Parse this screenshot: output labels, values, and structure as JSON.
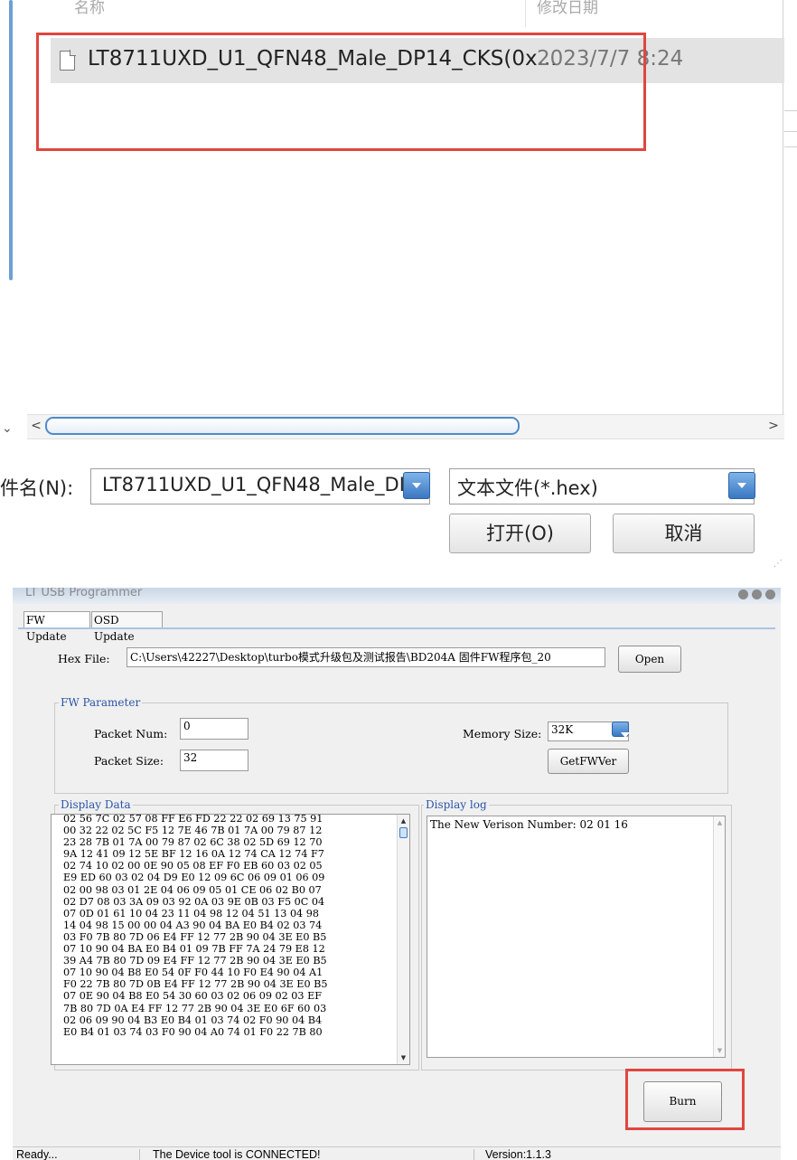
{
  "file_dialog": {
    "col_name_header": "名称",
    "col_date_header": "修改日期",
    "file": {
      "name": "LT8711UXD_U1_QFN48_Male_DP14_CKS(0x...",
      "modified": "2023/7/7 8:24"
    },
    "filename_label": "件名(N):",
    "filename_value": "LT8711UXD_U1_QFN48_Male_DI",
    "filetype_value": "文本文件(*.hex)",
    "open_button": "打开(O)",
    "cancel_button": "取消",
    "highlight_color": "#e0463e"
  },
  "programmer": {
    "title": "LT USB Programmer",
    "tabs": [
      {
        "label": "FW Update"
      },
      {
        "label": "OSD Update"
      }
    ],
    "hex_file_label": "Hex File:",
    "hex_file_path": "C:\\Users\\42227\\Desktop\\turbo模式升级包及测试报告\\BD204A 固件FW程序包_20",
    "open_button": "Open",
    "fw_parameter": {
      "title": "FW Parameter",
      "packet_num_label": "Packet Num:",
      "packet_num_value": "0",
      "packet_size_label": "Packet Size:",
      "packet_size_value": "32",
      "memory_size_label": "Memory Size:",
      "memory_size_value": "32K",
      "getfwver_button": "GetFWVer"
    },
    "display_data": {
      "title": "Display Data",
      "lines": [
        "02 56 7C 02 57 08 FF E6 FD 22 22 02 69 13 75 91",
        "00 32 22 02 5C F5 12 7E 46 7B 01 7A 00 79 87 12",
        "23 28 7B 01 7A 00 79 87 02 6C 38 02 5D 69 12 70",
        "9A 12 41 09 12 5E BF 12 16 0A 12 74 CA 12 74 F7",
        "02 74 10 02 00 0E 90 05 08 EF F0 EB 60 03 02 05",
        "E9 ED 60 03 02 04 D9 E0 12 09 6C 06 09 01 06 09",
        "02 00 98 03 01 2E 04 06 09 05 01 CE 06 02 B0 07",
        "02 D7 08 03 3A 09 03 92 0A 03 9E 0B 03 F5 0C 04",
        "07 0D 01 61 10 04 23 11 04 98 12 04 51 13 04 98",
        "14 04 98 15 00 00 04 A3 90 04 BA E0 B4 02 03 74",
        "03 F0 7B 80 7D 06 E4 FF 12 77 2B 90 04 3E E0 B5",
        "07 10 90 04 BA E0 B4 01 09 7B FF 7A 24 79 E8 12",
        "39 A4 7B 80 7D 09 E4 FF 12 77 2B 90 04 3E E0 B5",
        "07 10 90 04 B8 E0 54 0F F0 44 10 F0 E4 90 04 A1",
        "F0 22 7B 80 7D 0B E4 FF 12 77 2B 90 04 3E E0 B5",
        "07 0E 90 04 B8 E0 54 30 60 03 02 06 09 02 03 EF",
        "7B 80 7D 0A E4 FF 12 77 2B 90 04 3E E0 6F 60 03",
        "02 06 09 90 04 B3 E0 B4 01 03 74 02 F0 90 04 B4",
        "E0 B4 01 03 74 03 F0 90 04 A0 74 01 F0 22 7B 80"
      ]
    },
    "display_log": {
      "title": "Display log",
      "text": "The New Verison Number: 02 01 16"
    },
    "burn_button": "Burn",
    "status_bar": {
      "ready": "Ready...",
      "connection": "The Device tool is CONNECTED!",
      "version": "Version:1.1.3"
    },
    "highlight_color": "#e0463e"
  }
}
